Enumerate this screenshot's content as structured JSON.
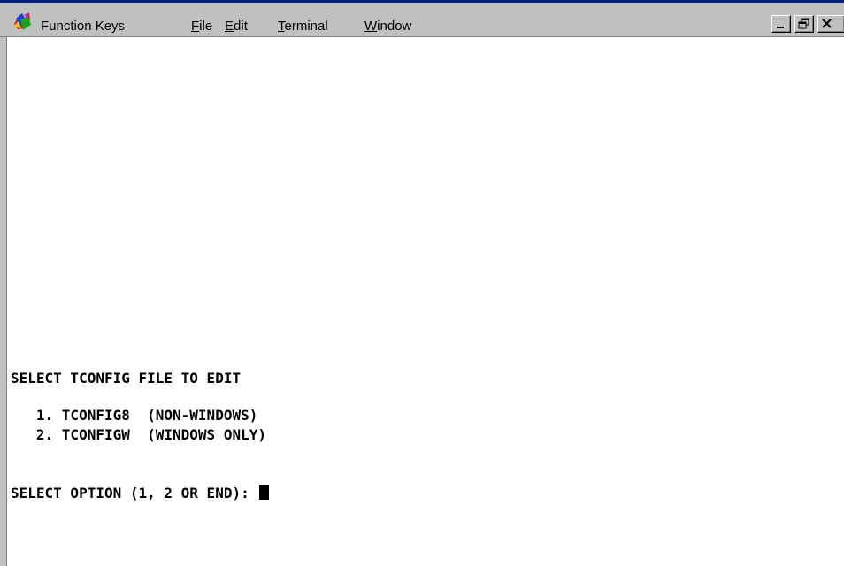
{
  "menubar": {
    "app_icon": "terminal-app-icon",
    "items": [
      {
        "label": "Function Keys"
      },
      {
        "mnemonic": "F",
        "rest": "ile"
      },
      {
        "mnemonic": "E",
        "rest": "dit"
      },
      {
        "mnemonic": "T",
        "rest": "erminal"
      },
      {
        "mnemonic": "W",
        "rest": "indow"
      }
    ],
    "controls": [
      "minimize-icon",
      "restore-icon",
      "close-icon"
    ]
  },
  "terminal": {
    "heading": "SELECT TCONFIG FILE TO EDIT",
    "options": [
      "   1. TCONFIG8  (NON-WINDOWS)",
      "   2. TCONFIGW  (WINDOWS ONLY)"
    ],
    "prompt": "SELECT OPTION (1, 2 OR END): "
  },
  "colors": {
    "title_edge": "#0a1f7a",
    "chrome": "#c0c0c0",
    "terminal_bg": "#ffffff",
    "terminal_fg": "#000000"
  }
}
